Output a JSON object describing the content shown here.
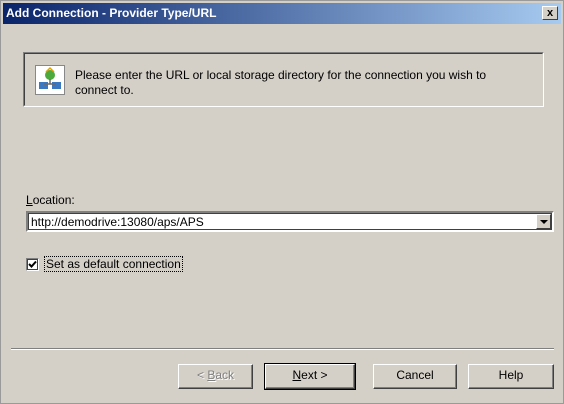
{
  "window": {
    "title": "Add Connection - Provider Type/URL",
    "close_label": "x"
  },
  "info": {
    "icon": "network-connection-icon",
    "text": "Please enter the URL or local storage directory for the connection you wish to connect to."
  },
  "location": {
    "label_accel": "L",
    "label_rest": "ocation:",
    "value": "http://demodrive:13080/aps/APS"
  },
  "default_connection": {
    "checked": true,
    "label": "Set as default connection"
  },
  "buttons": {
    "back_prefix": "< ",
    "back_accel": "B",
    "back_rest": "ack",
    "next_accel": "N",
    "next_rest": "ext >",
    "cancel": "Cancel",
    "help": "Help"
  }
}
